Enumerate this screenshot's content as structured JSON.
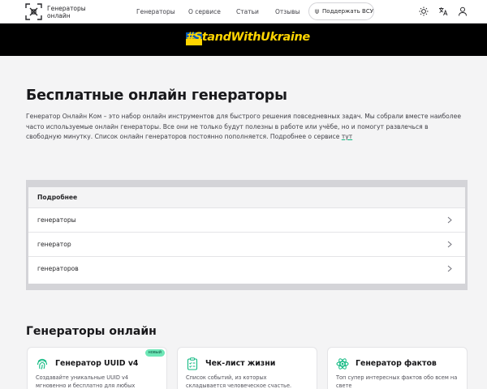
{
  "header": {
    "logo_text_line1": "Генераторы",
    "logo_text_line2": "онлайн",
    "nav": [
      "Генераторы",
      "О сервисе",
      "Статьи",
      "Отзывы"
    ],
    "support_label": "Поддержать ВСУ"
  },
  "banner": {
    "text": "#StandWithUkraine"
  },
  "hero": {
    "title": "Бесплатные онлайн генераторы",
    "description": "Генератор Онлайн Ком – это набор онлайн инструментов для быстрого решения повседневных задач. Мы собрали вместе наиболее часто используемые онлайн генераторы. Все они не только будут полезны в работе или учёбе, но и помогут развлечься в свободную минутку. Список онлайн генераторов постоянно пополняется. Подробнее о сервисе ",
    "link_text": "тут"
  },
  "details": {
    "heading": "Подробнее",
    "items": [
      "генераторы",
      "генератор",
      "генераторов"
    ]
  },
  "section2": {
    "title": "Генераторы онлайн",
    "cards": [
      {
        "title": "Генератор UUID v4",
        "desc": "Создавайте уникальные UUID v4 мгновенно и бесплатно для любых",
        "badge": "новый",
        "icon": "fingerprint-icon"
      },
      {
        "title": "Чек-лист жизни",
        "desc": "Список событий, из которых складывается человеческое счастье. Отметьте то,",
        "icon": "checklist-icon"
      },
      {
        "title": "Генератор фактов",
        "desc": "Топ супер интересных фактов обо всем на свете",
        "icon": "atom-icon"
      }
    ]
  },
  "colors": {
    "accent": "#10b981",
    "banner_bg": "#000000",
    "banner_text": "#ffd500"
  }
}
